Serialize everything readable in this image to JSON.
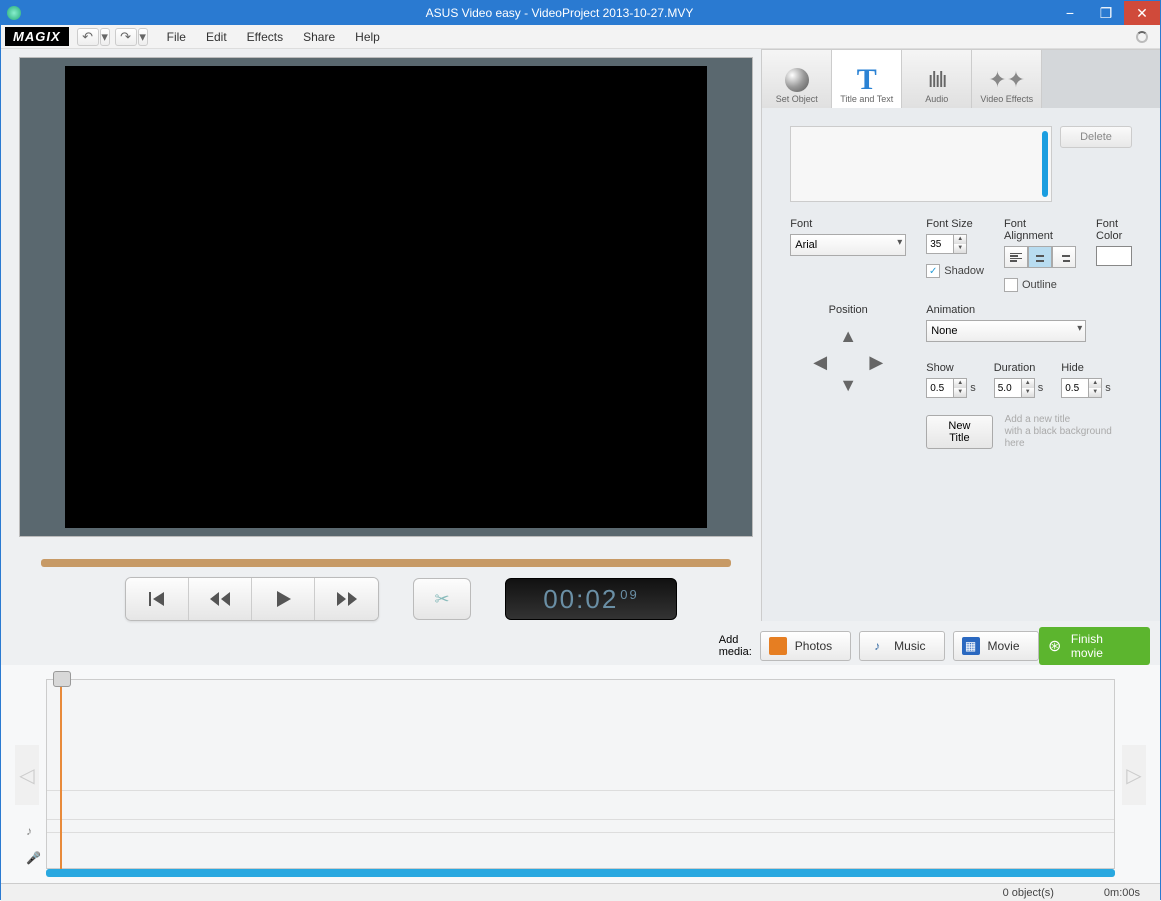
{
  "titlebar": {
    "title": "ASUS Video easy - VideoProject 2013-10-27.MVY"
  },
  "logo": "MAGIX",
  "menu": {
    "file": "File",
    "edit": "Edit",
    "effects": "Effects",
    "share": "Share",
    "help": "Help"
  },
  "timecode": {
    "main": "00:02",
    "frac": "09"
  },
  "tabs": {
    "setobject": "Set Object",
    "title": "Title and Text",
    "audio": "Audio",
    "videoeffects": "Video Effects"
  },
  "panel": {
    "delete": "Delete",
    "font_label": "Font",
    "font_value": "Arial",
    "fontsize_label": "Font Size",
    "fontsize_value": "35",
    "align_label": "Font Alignment",
    "fontcolor_label": "Font Color",
    "shadow": "Shadow",
    "outline": "Outline",
    "position": "Position",
    "animation_label": "Animation",
    "animation_value": "None",
    "show_label": "Show",
    "show_value": "0.5",
    "s": "s",
    "duration_label": "Duration",
    "duration_value": "5.0",
    "hide_label": "Hide",
    "hide_value": "0.5",
    "newtitle": "New Title",
    "addhint1": "Add a new title",
    "addhint2": "with a black background here"
  },
  "media": {
    "add": "Add media:",
    "photos": "Photos",
    "music": "Music",
    "movie": "Movie",
    "finish": "Finish movie"
  },
  "status": {
    "objects": "0 object(s)",
    "time": "0m:00s"
  }
}
